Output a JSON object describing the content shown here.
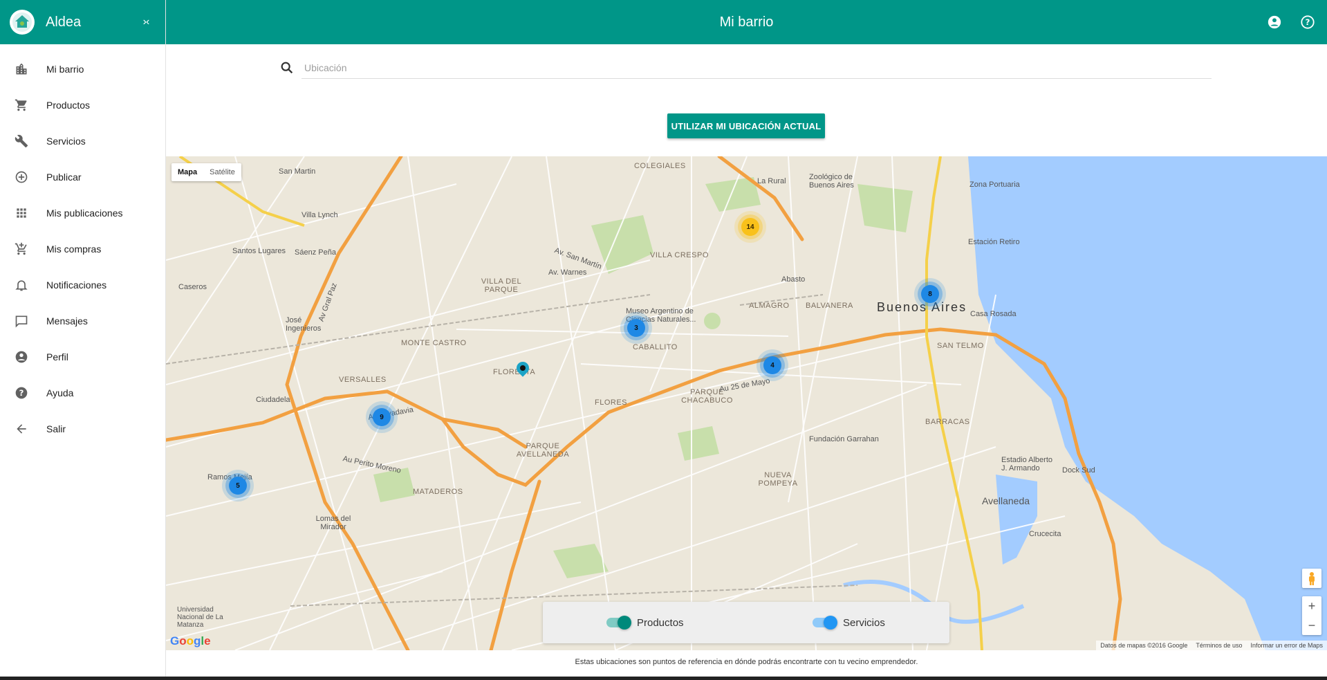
{
  "app": {
    "name": "Aldea",
    "collapse_label": "›‹"
  },
  "header": {
    "title": "Mi barrio"
  },
  "sidebar": {
    "items": [
      {
        "label": "Mi barrio",
        "icon": "city-icon"
      },
      {
        "label": "Productos",
        "icon": "cart-icon"
      },
      {
        "label": "Servicios",
        "icon": "tools-icon"
      },
      {
        "label": "Publicar",
        "icon": "add-circle-icon"
      },
      {
        "label": "Mis publicaciones",
        "icon": "grid-icon"
      },
      {
        "label": "Mis compras",
        "icon": "cart-plus-icon"
      },
      {
        "label": "Notificaciones",
        "icon": "bell-icon"
      },
      {
        "label": "Mensajes",
        "icon": "message-icon"
      },
      {
        "label": "Perfil",
        "icon": "account-icon"
      },
      {
        "label": "Ayuda",
        "icon": "help-icon"
      },
      {
        "label": "Salir",
        "icon": "arrow-back-icon"
      }
    ]
  },
  "search": {
    "placeholder": "Ubicación",
    "value": ""
  },
  "locate_button": "UTILIZAR MI UBICACIÓN ACTUAL",
  "map": {
    "type_buttons": {
      "map": "Mapa",
      "satellite": "Satélite"
    },
    "city_label": "Buenos Aires",
    "labels": {
      "colegiales": "COLEGIALES",
      "villa_crespo": "VILLA CRESPO",
      "villa_del_parque": "VILLA DEL PARQUE",
      "almagro": "ALMAGRO",
      "balvanera": "BALVANERA",
      "caballito": "CABALLITO",
      "flores": "FLORES",
      "parque_chacabuco": "PARQUE CHACABUCO",
      "nueva_pompeya": "NUEVA POMPEYA",
      "barracas": "BARRACAS",
      "san_telmo": "SAN TELMO",
      "parque_avellaneda": "PARQUE AVELLANEDA",
      "mataderos": "MATADEROS",
      "floresta": "FLORESTA",
      "monte_castro": "MONTE CASTRO",
      "versalles": "VERSALLES",
      "san_martin": "San Martin",
      "villa_lynch": "Villa Lynch",
      "santos_lugares": "Santos Lugares",
      "saenz_pena": "Sáenz Peña",
      "caseros": "Caseros",
      "jose_ingenieros": "José Ingenieros",
      "ciudadela": "Ciudadela",
      "ramos_mejia": "Ramos Mejía",
      "lomas_del_mirador": "Lomas del Mirador",
      "avellaneda": "Avellaneda",
      "crucecita": "Crucecita",
      "dock_sud": "Dock Sud",
      "zona_portuaria": "Zona Portuaria",
      "estacion_retiro": "Estación Retiro",
      "casa_rosada": "Casa Rosada",
      "abasto": "Abasto",
      "la_rural": "La Rural",
      "garrahan": "Fundación Garrahan",
      "museo": "Museo Argentino de Ciencias Naturales...",
      "zoologico": "Zoológico de Buenos Aires",
      "estadio": "Estadio Alberto J. Armando",
      "universidad": "Universidad Nacional de La Matanza",
      "av_25_de_mayo": "Au 25 de Mayo",
      "au_perito_moreno": "Au Perito Moreno",
      "av_gral_paz": "Av Gral Paz",
      "av_rivadavia": "Av. Rivadavia",
      "av_san_martin": "Av. San Martín",
      "av_warnes": "Av. Warnes"
    },
    "clusters": [
      {
        "count": "14",
        "color": "yellow"
      },
      {
        "count": "8",
        "color": "blue"
      },
      {
        "count": "3",
        "color": "blue"
      },
      {
        "count": "4",
        "color": "blue"
      },
      {
        "count": "9",
        "color": "blue"
      },
      {
        "count": "5",
        "color": "blue"
      }
    ],
    "google_logo": "Google",
    "attribution": {
      "data": "Datos de mapas ©2016 Google",
      "terms": "Términos de uso",
      "report": "Informar un error de Maps"
    },
    "zoom_in": "+",
    "zoom_out": "−"
  },
  "toggles": {
    "products": {
      "label": "Productos",
      "on": true,
      "color": "#00897b"
    },
    "services": {
      "label": "Servicios",
      "on": true,
      "color": "#2196f3"
    }
  },
  "footnote": "Estas ubicaciones son puntos de referencia en dónde podrás encontrarte con tu vecino emprendedor.",
  "colors": {
    "primary": "#009688",
    "water": "#a3ccff",
    "highway": "#f2a041"
  }
}
